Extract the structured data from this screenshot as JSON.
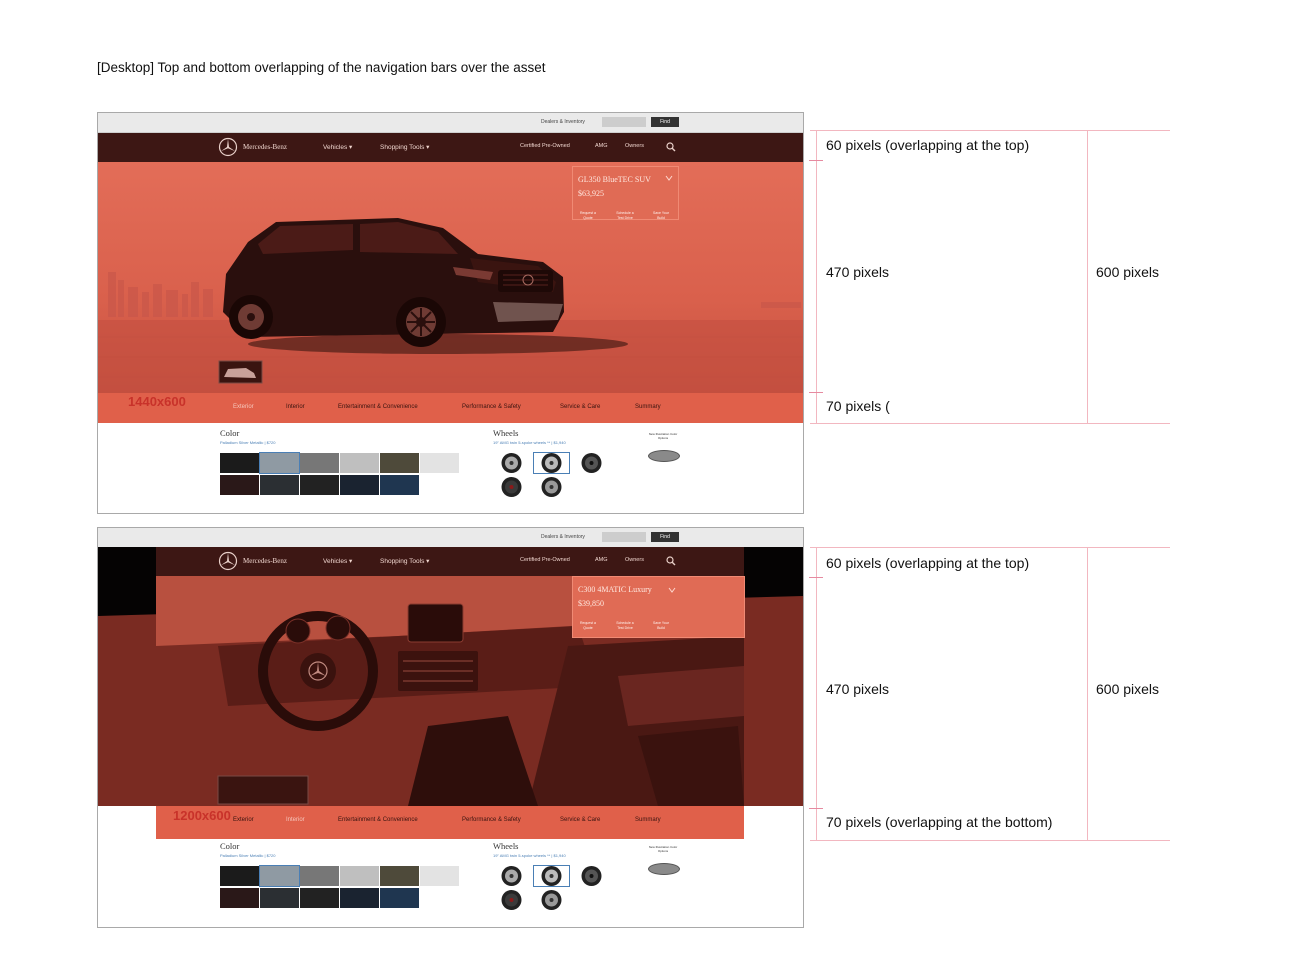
{
  "page_title": "[Desktop] Top and bottom overlapping of the navigation bars over the asset",
  "colors": {
    "hero_overlay": "#e06b55",
    "nav_bar": "#3d1714",
    "tab_bar": "#e0604a",
    "annotation_line": "#f2b7c0",
    "size_label": "#c8322a"
  },
  "mockups": [
    {
      "utility": {
        "dealers_label": "Dealers & Inventory",
        "find_label": "Find"
      },
      "nav": {
        "brand": "Mercedes-Benz",
        "items": [
          "Vehicles ▾",
          "Shopping Tools ▾"
        ],
        "right_items": [
          "Certified Pre-Owned",
          "AMG",
          "Owners"
        ]
      },
      "price_box": {
        "model": "GL350 BlueTEC SUV",
        "price": "$63,925",
        "actions": [
          "Request a Quote",
          "Schedule a Test Drive",
          "Save Your Build"
        ]
      },
      "size_label": "1440x600",
      "tabs": [
        "Exterior",
        "Interior",
        "Entertainment & Convenience",
        "Performance & Safety",
        "Service & Care",
        "Summary"
      ],
      "color_heading": "Color",
      "color_sub": "Palladium Silver Metallic | $720",
      "wheels_heading": "Wheels",
      "wheels_sub": "19\" AMG twin 5-spoke wheels ** | $1,940",
      "badge_text": "New Illustration Color Options"
    },
    {
      "utility": {
        "dealers_label": "Dealers & Inventory",
        "find_label": "Find"
      },
      "nav": {
        "brand": "Mercedes-Benz",
        "items": [
          "Vehicles ▾",
          "Shopping Tools ▾"
        ],
        "right_items": [
          "Certified Pre-Owned",
          "AMG",
          "Owners"
        ]
      },
      "price_box": {
        "model": "C300 4MATIC Luxury",
        "price": "$39,850",
        "actions": [
          "Request a Quote",
          "Schedule a Test Drive",
          "Save Your Build"
        ]
      },
      "size_label": "1200x600",
      "tabs": [
        "Exterior",
        "Interior",
        "Entertainment & Convenience",
        "Performance & Safety",
        "Service & Care",
        "Summary"
      ],
      "color_heading": "Color",
      "color_sub": "Palladium Silver Metallic | $720",
      "wheels_heading": "Wheels",
      "wheels_sub": "19\" AMG twin 5-spoke wheels ** | $1,940",
      "badge_text": "New Illustration Color Options"
    }
  ],
  "annotations": [
    {
      "top": "60 pixels (overlapping at the top)",
      "middle": "470 pixels",
      "bottom": "70 pixels (",
      "total": "600 pixels"
    },
    {
      "top": "60 pixels (overlapping at the top)",
      "middle": "470 pixels",
      "bottom": "70 pixels (overlapping at the bottom)",
      "total": "600 pixels"
    }
  ]
}
